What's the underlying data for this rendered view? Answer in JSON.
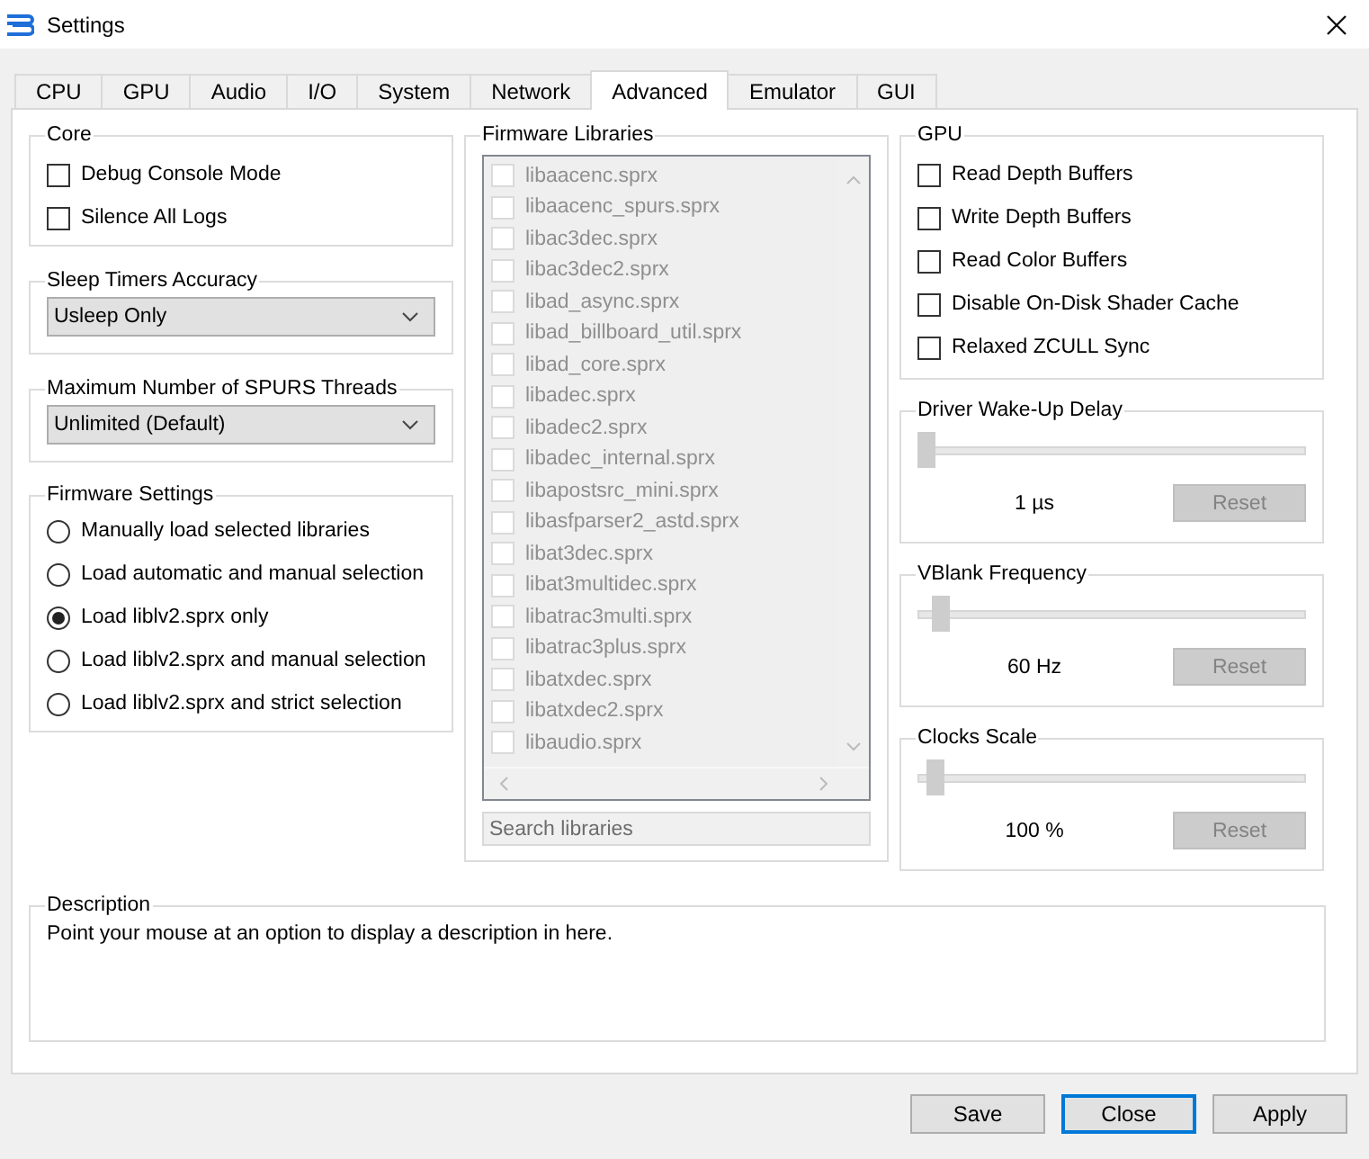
{
  "window": {
    "title": "Settings"
  },
  "tabs": [
    {
      "label": "CPU",
      "selected": false
    },
    {
      "label": "GPU",
      "selected": false
    },
    {
      "label": "Audio",
      "selected": false
    },
    {
      "label": "I/O",
      "selected": false
    },
    {
      "label": "System",
      "selected": false
    },
    {
      "label": "Network",
      "selected": false
    },
    {
      "label": "Advanced",
      "selected": true
    },
    {
      "label": "Emulator",
      "selected": false
    },
    {
      "label": "GUI",
      "selected": false
    }
  ],
  "core": {
    "title": "Core",
    "options": [
      {
        "label": "Debug Console Mode",
        "checked": false
      },
      {
        "label": "Silence All Logs",
        "checked": false
      }
    ]
  },
  "dropdowns": [
    {
      "title": "Sleep Timers Accuracy",
      "value": "Usleep Only"
    },
    {
      "title": "Maximum Number of SPURS Threads",
      "value": "Unlimited (Default)"
    }
  ],
  "firmware_settings": {
    "title": "Firmware Settings",
    "options": [
      {
        "label": "Manually load selected libraries",
        "selected": false
      },
      {
        "label": "Load automatic and manual selection",
        "selected": false
      },
      {
        "label": "Load liblv2.sprx only",
        "selected": true
      },
      {
        "label": "Load liblv2.sprx and manual selection",
        "selected": false
      },
      {
        "label": "Load liblv2.sprx and strict selection",
        "selected": false
      }
    ]
  },
  "firmware_libraries": {
    "title": "Firmware Libraries",
    "items": [
      {
        "label": "libaacenc.sprx",
        "checked": false,
        "disabled": true
      },
      {
        "label": "libaacenc_spurs.sprx",
        "checked": false,
        "disabled": true
      },
      {
        "label": "libac3dec.sprx",
        "checked": false,
        "disabled": true
      },
      {
        "label": "libac3dec2.sprx",
        "checked": false,
        "disabled": true
      },
      {
        "label": "libad_async.sprx",
        "checked": false,
        "disabled": true
      },
      {
        "label": "libad_billboard_util.sprx",
        "checked": false,
        "disabled": true
      },
      {
        "label": "libad_core.sprx",
        "checked": false,
        "disabled": true
      },
      {
        "label": "libadec.sprx",
        "checked": false,
        "disabled": true
      },
      {
        "label": "libadec2.sprx",
        "checked": false,
        "disabled": true
      },
      {
        "label": "libadec_internal.sprx",
        "checked": false,
        "disabled": true
      },
      {
        "label": "libapostsrc_mini.sprx",
        "checked": false,
        "disabled": true
      },
      {
        "label": "libasfparser2_astd.sprx",
        "checked": false,
        "disabled": true
      },
      {
        "label": "libat3dec.sprx",
        "checked": false,
        "disabled": true
      },
      {
        "label": "libat3multidec.sprx",
        "checked": false,
        "disabled": true
      },
      {
        "label": "libatrac3multi.sprx",
        "checked": false,
        "disabled": true
      },
      {
        "label": "libatrac3plus.sprx",
        "checked": false,
        "disabled": true
      },
      {
        "label": "libatxdec.sprx",
        "checked": false,
        "disabled": true
      },
      {
        "label": "libatxdec2.sprx",
        "checked": false,
        "disabled": true
      },
      {
        "label": "libaudio.sprx",
        "checked": false,
        "disabled": true
      }
    ],
    "search": {
      "placeholder": "Search libraries"
    }
  },
  "gpu": {
    "title": "GPU",
    "options": [
      {
        "label": "Read Depth Buffers",
        "checked": false
      },
      {
        "label": "Write Depth Buffers",
        "checked": false
      },
      {
        "label": "Read Color Buffers",
        "checked": false
      },
      {
        "label": "Disable On-Disk Shader Cache",
        "checked": false
      },
      {
        "label": "Relaxed ZCULL Sync",
        "checked": false
      }
    ]
  },
  "sliders": [
    {
      "title": "Driver Wake-Up Delay",
      "level": 0,
      "reading": "1 µs",
      "reset": {
        "label": "Reset",
        "disabled": true
      }
    },
    {
      "title": "VBlank Frequency",
      "level": 0.04,
      "reading": "60 Hz",
      "reset": {
        "label": "Reset",
        "disabled": true
      }
    },
    {
      "title": "Clocks Scale",
      "level": 0.025,
      "reading": "100 %",
      "reset": {
        "label": "Reset",
        "disabled": true
      }
    }
  ],
  "description": {
    "title": "Description",
    "text": "Point your mouse at an option to display a description in here."
  },
  "buttons": [
    {
      "label": "Save",
      "focused": false
    },
    {
      "label": "Close",
      "focused": true
    },
    {
      "label": "Apply",
      "focused": false
    }
  ]
}
